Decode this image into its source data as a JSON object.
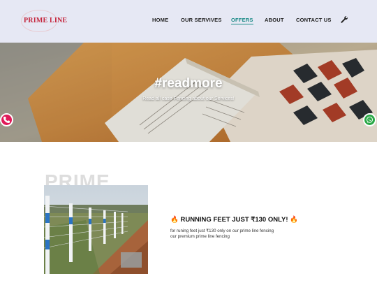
{
  "brand": {
    "logo_text": "PRIME LINE"
  },
  "nav": {
    "items": [
      {
        "label": "HOME"
      },
      {
        "label": "OUR SERVIVES"
      },
      {
        "label": "OFFERS"
      },
      {
        "label": "ABOUT"
      },
      {
        "label": "CONTACT US"
      }
    ],
    "active": "OFFERS",
    "extra_icon": "wrench-icon"
  },
  "hero": {
    "title": "#readmore",
    "subtitle": "Read all case Fencing about our Services!"
  },
  "floating": {
    "call_icon": "phone-icon",
    "call_color": "#e01a59",
    "whatsapp_icon": "whatsapp-icon",
    "whatsapp_color": "#29a846"
  },
  "offer": {
    "watermark": "PRIME",
    "title": "🔥 RUNNING FEET JUST ₹130 ONLY! 🔥",
    "line1": "for runing feet just ₹130 only on our prime line fencing",
    "line2": "our premium prime line fencing"
  },
  "colors": {
    "accent": "#1a8a86",
    "brand": "#c4233a",
    "header_bg": "#e6e8f4"
  }
}
